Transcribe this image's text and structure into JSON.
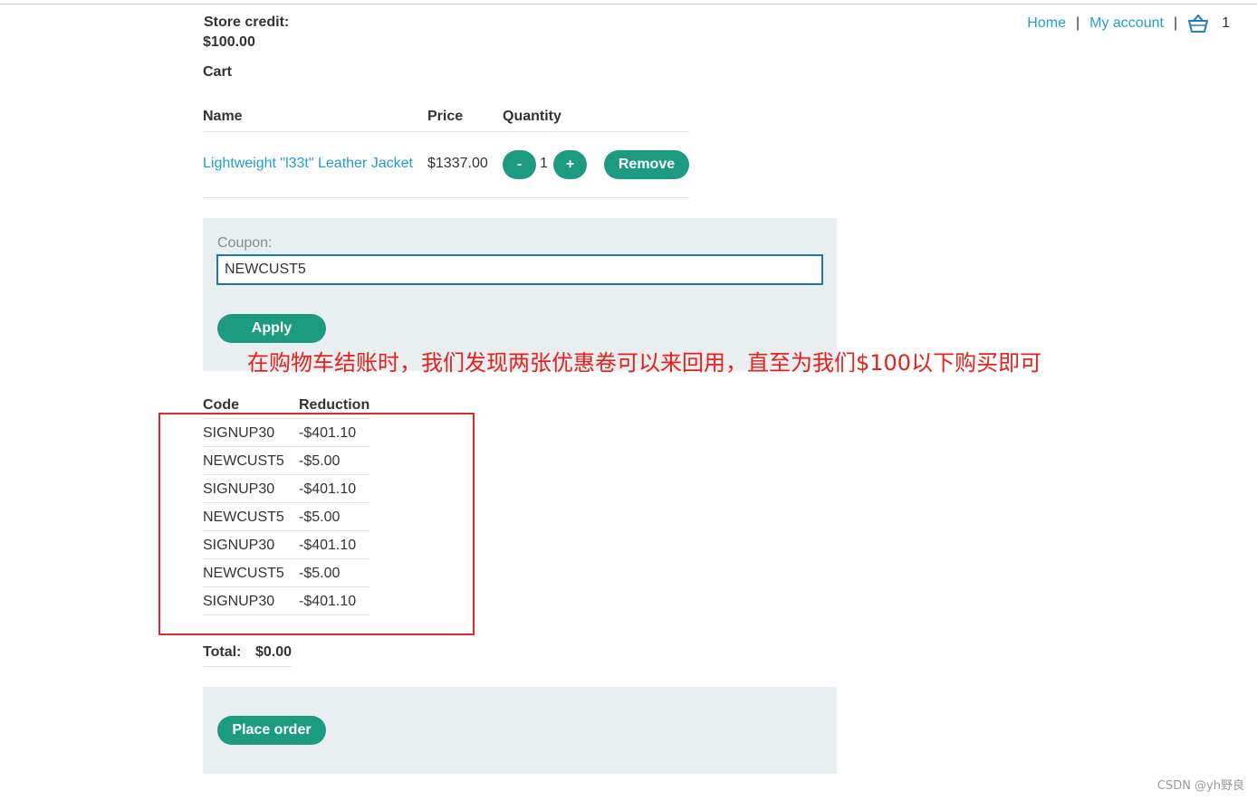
{
  "nav": {
    "home": "Home",
    "separator": "|",
    "my_account": "My account",
    "cart_count": "1"
  },
  "store_credit": {
    "label": "Store credit:",
    "amount": "$100.00"
  },
  "cart": {
    "title": "Cart",
    "columns": [
      "Name",
      "Price",
      "Quantity"
    ],
    "item": {
      "name": "Lightweight \"l33t\" Leather Jacket",
      "price": "$1337.00",
      "quantity": "1",
      "decrement_label": "-",
      "increment_label": "+",
      "remove_label": "Remove"
    }
  },
  "coupon": {
    "label": "Coupon:",
    "value": "NEWCUST5",
    "apply_label": "Apply"
  },
  "annotation": "在购物车结账时，我们发现两张优惠卷可以来回用，直至为我们$100以下购买即可",
  "applied_coupons": {
    "columns": [
      "Code",
      "Reduction"
    ],
    "rows": [
      [
        "SIGNUP30",
        "-$401.10"
      ],
      [
        "NEWCUST5",
        "-$5.00"
      ],
      [
        "SIGNUP30",
        "-$401.10"
      ],
      [
        "NEWCUST5",
        "-$5.00"
      ],
      [
        "SIGNUP30",
        "-$401.10"
      ],
      [
        "NEWCUST5",
        "-$5.00"
      ],
      [
        "SIGNUP30",
        "-$401.10"
      ]
    ]
  },
  "total": {
    "label": "Total:",
    "value": "$0.00"
  },
  "place_order_label": "Place order",
  "watermark": "CSDN @yh野良",
  "colors": {
    "link": "#1f9ecf",
    "button": "#1d9b81",
    "panel": "#e9eff1",
    "annotation": "#e8201c",
    "input_border": "#1d78a8"
  }
}
